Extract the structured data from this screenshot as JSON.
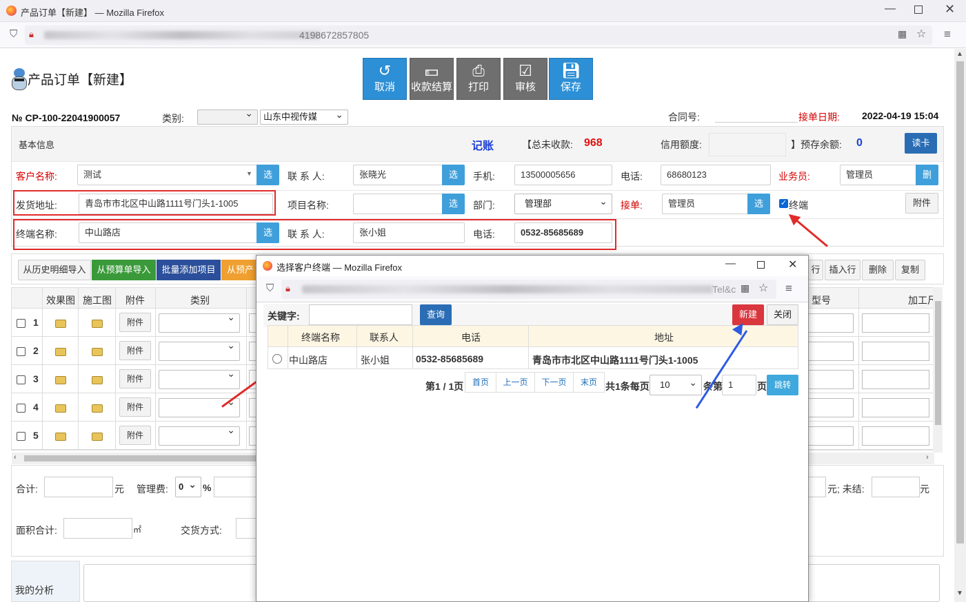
{
  "browser": {
    "title": "产品订单【新建】 — Mozilla Firefox",
    "url_suffix": "4198672857805"
  },
  "header": {
    "page_title": "产品订单【新建】",
    "buttons": [
      {
        "label": "取消",
        "icon": "undo-icon"
      },
      {
        "label": "收款结算",
        "icon": "money-icon"
      },
      {
        "label": "打印",
        "icon": "printer-icon"
      },
      {
        "label": "审核",
        "icon": "check-icon"
      },
      {
        "label": "保存",
        "icon": "save-icon"
      }
    ],
    "order_no": "№ CP-100-22041900057",
    "category_label": "类别:",
    "category_value": "",
    "company_value": "山东中视传媒",
    "contract_label": "合同号:",
    "order_date_label": "接单日期:",
    "order_date_value": "2022-04-19 15:04"
  },
  "info_bar": {
    "section_title": "基本信息",
    "ledger": "记账",
    "unpaid_label": "【总未收款:",
    "unpaid_value": "968",
    "credit_label": "信用额度:",
    "prepaid_label": "】预存余额:",
    "prepaid_value": "0",
    "read_card": "读卡"
  },
  "form": {
    "customer_label": "客户名称:",
    "customer_value": "测试",
    "contact_label": "联 系 人:",
    "contact_value": "张晓光",
    "mobile_label": "手机:",
    "mobile_value": "13500005656",
    "phone_label": "电话:",
    "phone_value": "68680123",
    "salesman_label": "业务员:",
    "salesman_value": "管理员",
    "delete_btn": "删",
    "address_label": "发货地址:",
    "address_value": "青岛市市北区中山路1111号门头1-1005",
    "project_label": "项目名称:",
    "project_value": "",
    "dept_label": "部门:",
    "dept_value": "管理部",
    "receiver_label": "接单:",
    "receiver_value": "管理员",
    "terminal_check": "终端",
    "attach_btn": "附件",
    "terminal_label": "终端名称:",
    "terminal_value": "中山路店",
    "t_contact_label": "联 系 人:",
    "t_contact_value": "张小姐",
    "t_phone_label": "电话:",
    "t_phone_value": "0532-85685689",
    "select_btn": "选"
  },
  "toolbar": {
    "from_history": "从历史明细导入",
    "from_budget": "从预算单导入",
    "batch_add": "批量添加项目",
    "from_pre": "从预产品",
    "row_op_partial": "行",
    "insert_row": "插入行",
    "delete": "删除",
    "copy": "复制"
  },
  "grid": {
    "headers": [
      "效果图",
      "施工图",
      "附件",
      "类别"
    ],
    "right_headers": [
      "型号",
      "加工尺"
    ],
    "rows": [
      "1",
      "2",
      "3",
      "4",
      "5"
    ],
    "attach_label": "附件"
  },
  "footer": {
    "total_label": "合计:",
    "yuan": "元",
    "mgmt_label": "管理费:",
    "mgmt_value": "0",
    "percent": "%",
    "end_label": "元; 未结:",
    "area_label": "面积合计:",
    "sqm": "㎡",
    "delivery_label": "交货方式:",
    "analysis_label": "我的分析"
  },
  "popup": {
    "title": "选择客户终端 — Mozilla Firefox",
    "url_tail": "Tel&c",
    "keyword_label": "关键字:",
    "search_btn": "查询",
    "new_btn": "新建",
    "close_btn": "关闭",
    "columns": [
      "终端名称",
      "联系人",
      "电话",
      "地址"
    ],
    "rows": [
      {
        "name": "中山路店",
        "contact": "张小姐",
        "phone": "0532-85685689",
        "address": "青岛市市北区中山路1111号门头1-1005"
      }
    ],
    "page_info": "第1 / 1页",
    "first": "首页",
    "prev": "上一页",
    "next": "下一页",
    "last": "末页",
    "total_per": "共1条每页",
    "per_page": "10",
    "goto_prefix": "条第",
    "goto_value": "1",
    "page_suffix": "页",
    "jump_btn": "跳转"
  },
  "colors": {
    "primary": "#2d8fd5",
    "danger": "#d9363e",
    "green": "#3a9a3a",
    "navy": "#2b4f9a",
    "orange": "#f0a030",
    "annotation_red": "#e02b2b",
    "annotation_blue": "#2d5be3"
  }
}
